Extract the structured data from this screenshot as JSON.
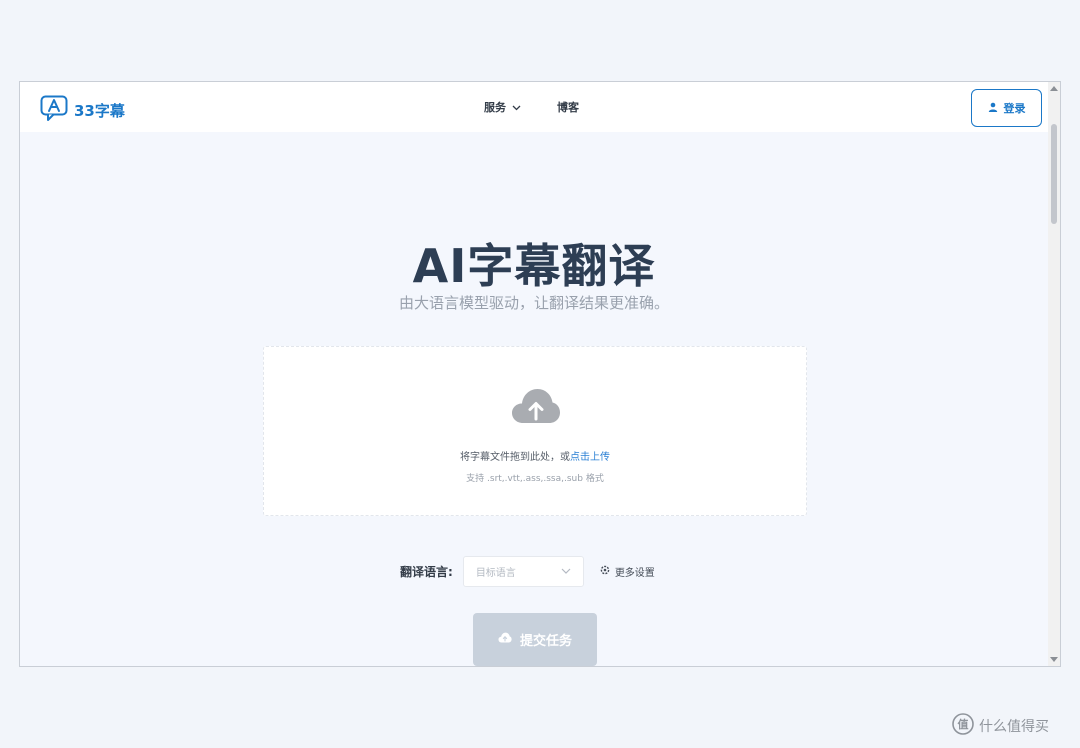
{
  "navbar": {
    "logo_text": "33字幕",
    "nav_items": [
      {
        "label": "服务",
        "has_dropdown": true
      },
      {
        "label": "博客",
        "has_dropdown": false
      }
    ],
    "login_label": "登录"
  },
  "hero": {
    "title": "AI字幕翻译",
    "subtitle": "由大语言模型驱动，让翻译结果更准确。"
  },
  "upload": {
    "text_prefix": "将字幕文件拖到此处，或",
    "text_link": "点击上传",
    "hint": "支持 .srt,.vtt,.ass,.ssa,.sub 格式"
  },
  "translate": {
    "label": "翻译语言:",
    "select_placeholder": "目标语言",
    "more_settings": "更多设置"
  },
  "submit": {
    "label": "提交任务"
  },
  "watermark": {
    "text": "什么值得买"
  },
  "colors": {
    "brand": "#1b78c8",
    "title": "#2d3e54",
    "disabled_button": "#c8d1dc",
    "page_bg": "#f4f7fd"
  },
  "icons": {
    "logo": "translate-bubble-icon",
    "dropdown": "chevron-down-icon",
    "login": "user-icon",
    "upload": "cloud-upload-icon",
    "settings": "gear-icon",
    "submit": "cloud-upload-icon"
  }
}
